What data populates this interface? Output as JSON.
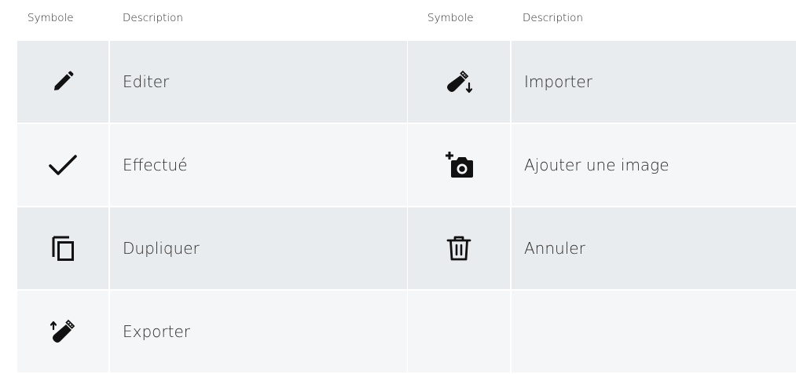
{
  "headers": {
    "left": {
      "symbol": "Symbole",
      "description": "Description"
    },
    "right": {
      "symbol": "Symbole",
      "description": "Description"
    }
  },
  "left_rows": [
    {
      "icon": "pencil-icon",
      "label": "Editer"
    },
    {
      "icon": "checkmark-icon",
      "label": "Effectué"
    },
    {
      "icon": "duplicate-icon",
      "label": "Dupliquer"
    },
    {
      "icon": "usb-export-icon",
      "label": "Exporter"
    }
  ],
  "right_rows": [
    {
      "icon": "usb-import-icon",
      "label": "Importer"
    },
    {
      "icon": "add-photo-icon",
      "label": "Ajouter une image"
    },
    {
      "icon": "trash-icon",
      "label": "Annuler"
    },
    {
      "icon": "",
      "label": ""
    }
  ],
  "colors": {
    "row_dark": "#e9ecef",
    "row_light": "#f5f6f8",
    "icon": "#111111"
  }
}
